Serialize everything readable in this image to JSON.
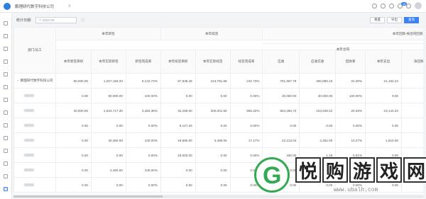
{
  "header": {
    "company": "鹏理研代数字科技公司",
    "fold_icon": "fold-icon",
    "notif_count": "18"
  },
  "filter": {
    "label": "统计日期:",
    "date_value": "2024-09",
    "reset_label": "重置",
    "export_label": "导出",
    "query_label": "查询"
  },
  "table": {
    "dept_header": "部门/员工",
    "group_headers": [
      "本年新签",
      "本年续签",
      "本年回款-按合同回款方式统计"
    ],
    "subgroup_header": "本年合同",
    "sub_headers_new": [
      "本年新签目标",
      "本年实际新签",
      "新签完成率"
    ],
    "sub_headers_renew": [
      "本年续签目标",
      "本年实际续签",
      "续签完成率"
    ],
    "sub_headers_payment": [
      "应收",
      "应收实收",
      "回款率",
      "本年支出",
      "净回款率"
    ],
    "rows": [
      {
        "name": "鹏理研代数字科技公司",
        "expand": "−",
        "values": [
          "80,000.00",
          "1,027,193.20",
          "8,122.73%",
          "87,838.28",
          "213,781.68",
          "242.73%",
          "701,587.78",
          "350,880.16",
          "24.00%",
          "21,183.24",
          "30.57%"
        ]
      },
      {
        "name": "",
        "values": [
          "0.00",
          "90,000.00",
          "100.00%",
          "0.00",
          "0.00",
          "0.00%",
          "30,000.00",
          "30,000.00",
          "100.00%",
          "0.00",
          "100.00%"
        ]
      },
      {
        "name": "",
        "values": [
          "30,000.00",
          "1,844,717.30",
          "3,482.39%",
          "32,299.00",
          "200,001.60",
          "865.32%",
          "804,280.73",
          "104,039.22",
          "20.49%",
          "23,143.34",
          "18.94%"
        ]
      },
      {
        "name": "",
        "values": [
          "0.00",
          "0.00",
          "0.00%",
          "8,127.26",
          "0.00",
          "0.00%",
          "0.00",
          "0.00",
          "0.00%",
          "0.00",
          "0.00%"
        ]
      },
      {
        "name": "",
        "values": [
          "0.00",
          "30,350.00",
          "100.00%",
          "19,880.00",
          "3,489.00",
          "17.17%",
          "22,213.04",
          "2,282.00",
          "10.27%",
          "1,810.00",
          "2.16%"
        ]
      },
      {
        "name": "",
        "values": [
          "0.00",
          "0.00",
          "0.00%",
          "19,000.00",
          "0.00",
          "0.00%",
          "180.00",
          "1.18",
          "0.61%",
          "0.00",
          "0.61%"
        ]
      },
      {
        "name": "",
        "values": [
          "0.00",
          "2,460.00",
          "100.00%",
          "0.00",
          "0.00",
          "0.00%",
          "0.00",
          "0.00",
          "0.00%",
          "0.00",
          "0.00%"
        ]
      },
      {
        "name": "",
        "values": [
          "0.00",
          "0.00",
          "0.00%",
          "0.00",
          "0.00",
          "0.00%",
          "0.00",
          "0.00",
          "0.00%",
          "0.00",
          "0.00%"
        ]
      }
    ]
  },
  "watermark": {
    "chars": [
      "悦",
      "购",
      "游",
      "戏",
      "网"
    ],
    "url": "www.ubalh.com",
    "logo_letter": "G"
  }
}
